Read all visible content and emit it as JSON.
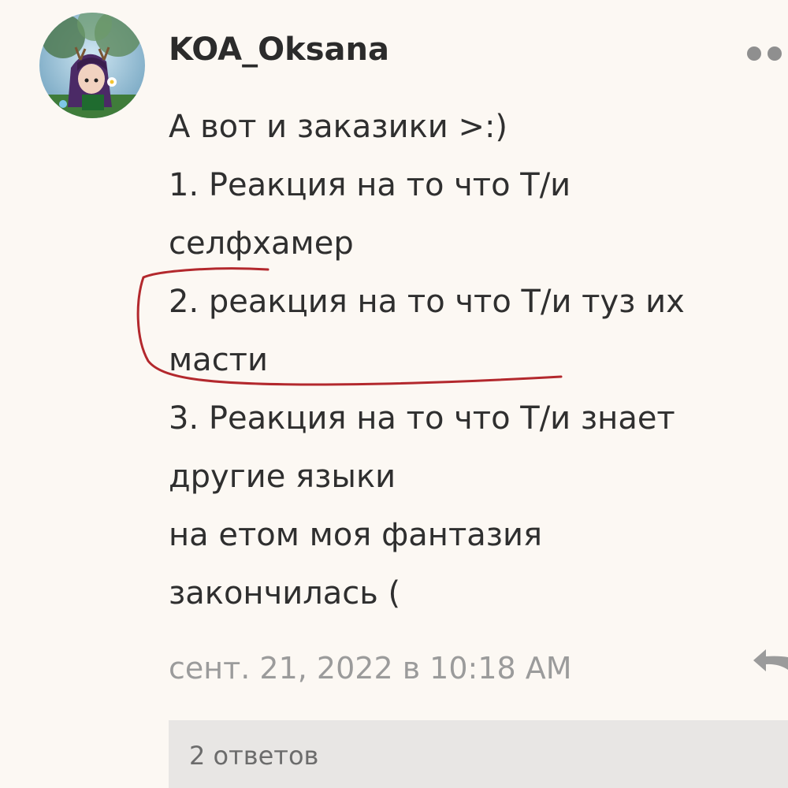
{
  "comment": {
    "author": "KOA_Oksana",
    "avatar": "avatar-image",
    "lines": [
      "А вот и заказики >:)",
      "1. Реакция на то что Т/и",
      "селфхамер",
      "2. реакция на то что Т/и туз их",
      "масти",
      "3. Реакция на то что Т/и знает",
      "другие языки",
      "на етом моя фантазия",
      "закончилась ("
    ],
    "timestamp": "сент. 21, 2022 в 10:18 AM",
    "replies_label": "2 ответов",
    "more_icon": "more-dots-icon",
    "reply_icon": "reply-arrow-icon"
  },
  "colors": {
    "background": "#fcf8f3",
    "annotation": "#b3282d",
    "replies_bar": "#e8e6e4"
  }
}
